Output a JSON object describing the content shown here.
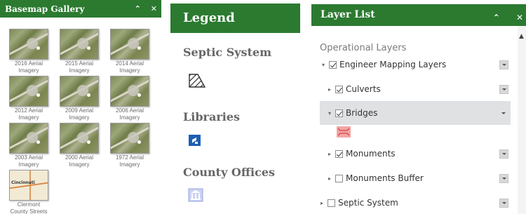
{
  "basemap": {
    "title": "Basemap Gallery",
    "items": [
      {
        "label": "2016 Aerial Imagery",
        "line1": "2016 Aerial",
        "line2": "Imagery"
      },
      {
        "label": "2015 Aerial Imagery",
        "line1": "2015 Aerial",
        "line2": "Imagery"
      },
      {
        "label": "2014 Aerial Imagery",
        "line1": "2014 Aerial",
        "line2": "Imagery"
      },
      {
        "label": "2012 Aerial Imagery",
        "line1": "2012 Aerial",
        "line2": "Imagery"
      },
      {
        "label": "2009 Aerial Imagery",
        "line1": "2009 Aerial",
        "line2": "Imagery"
      },
      {
        "label": "2006 Aerial Imagery",
        "line1": "2006 Aerial",
        "line2": "Imagery"
      },
      {
        "label": "2003 Aerial Imagery",
        "line1": "2003 Aerial",
        "line2": "Imagery"
      },
      {
        "label": "2000 Aerial Imagery",
        "line1": "2000 Aerial",
        "line2": "Imagery"
      },
      {
        "label": "1972 Aerial Imagery",
        "line1": "1972 Aerial",
        "line2": "Imagery"
      },
      {
        "label": "Clermont County Streets",
        "line1": "Clermont",
        "line2": "County Streets",
        "thumb_text": "Cincinnati"
      }
    ]
  },
  "legend": {
    "title": "Legend",
    "sections": [
      {
        "title": "Septic System",
        "symbol": "hatched-polygon-icon"
      },
      {
        "title": "Libraries",
        "symbol": "library-icon"
      },
      {
        "title": "County Offices",
        "symbol": "government-building-icon"
      }
    ]
  },
  "layer_list": {
    "title": "Layer List",
    "section_title": "Operational Layers",
    "layers": [
      {
        "label": "Engineer Mapping Layers",
        "checked": true,
        "expanded": true
      },
      {
        "label": "Culverts",
        "checked": true,
        "expanded": false
      },
      {
        "label": "Bridges",
        "checked": true,
        "expanded": true,
        "selected": true
      },
      {
        "label": "Monuments",
        "checked": true,
        "expanded": false
      },
      {
        "label": "Monuments Buffer",
        "checked": false,
        "expanded": false
      },
      {
        "label": "Septic System",
        "checked": false,
        "expanded": false
      }
    ]
  },
  "colors": {
    "header_green": "#2b7a30",
    "bridge_symbol": "#f3a5a5",
    "library_blue": "#1d5fb4"
  }
}
